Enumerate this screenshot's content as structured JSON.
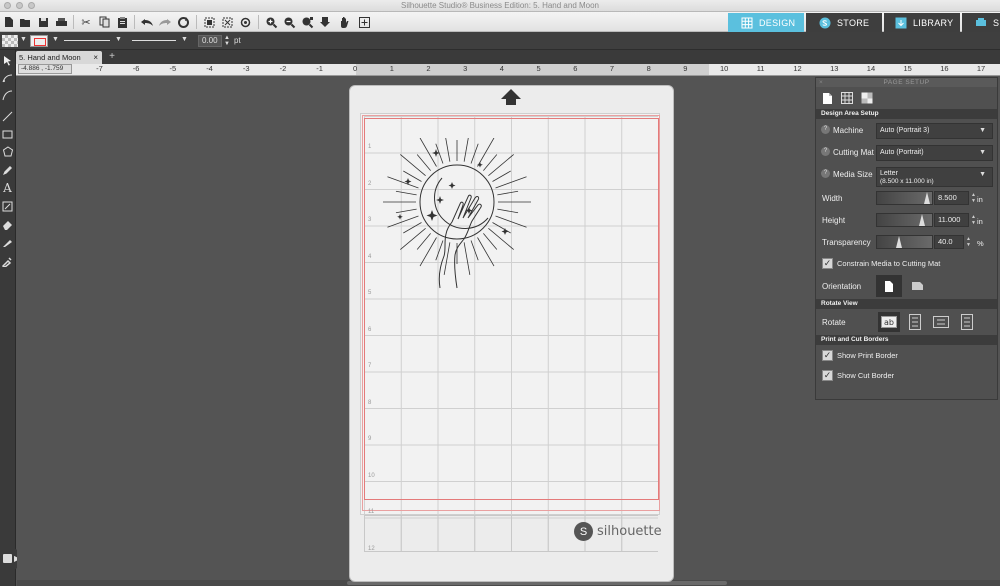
{
  "window": {
    "title": "Silhouette Studio® Business Edition: 5. Hand and Moon"
  },
  "toolbar": {
    "icons": [
      "new-icon",
      "open-icon",
      "save-icon",
      "print-icon",
      "cut-icon",
      "copy-icon",
      "paste-icon",
      "undo-icon",
      "redo-icon",
      "refresh-icon",
      "group-icon",
      "ungroup-icon",
      "select-all-icon",
      "zoom-in-icon",
      "zoom-out-icon",
      "zoom-fit-icon",
      "move-down-icon",
      "pan-hand-icon",
      "add-page-icon"
    ]
  },
  "top_tabs": [
    {
      "label": "DESIGN",
      "icon": "grid-icon",
      "active": true,
      "color": "#5bc0de"
    },
    {
      "label": "STORE",
      "icon": "store-icon",
      "active": false,
      "color": "#3e3e3e"
    },
    {
      "label": "LIBRARY",
      "icon": "library-icon",
      "active": false,
      "color": "#3e3e3e"
    },
    {
      "label": "S",
      "icon": "send-icon",
      "active": false,
      "color": "#3e3e3e"
    }
  ],
  "options": {
    "line_width": "0.00",
    "line_unit": "pt"
  },
  "document_tab": {
    "label": "5. Hand and Moon",
    "close": "×",
    "add": "+"
  },
  "ruler": {
    "coords": "-4.886 , -1.759",
    "ticks": [
      "-7",
      "-6",
      "-5",
      "-4",
      "-3",
      "-2",
      "-1",
      "0",
      "1",
      "2",
      "3",
      "4",
      "5",
      "6",
      "7",
      "8",
      "9",
      "10",
      "11",
      "12",
      "13",
      "14",
      "15",
      "16",
      "17"
    ]
  },
  "canvas": {
    "brand_text": "silhouette",
    "row_numbers": [
      "1",
      "2",
      "3",
      "4",
      "5",
      "6",
      "7",
      "8",
      "9",
      "10",
      "11",
      "12"
    ]
  },
  "page_setup": {
    "header": "PAGE SETUP",
    "design_area_title": "Design Area Setup",
    "machine_label": "Machine",
    "machine_value": "Auto (Portrait 3)",
    "cutting_mat_label": "Cutting Mat",
    "cutting_mat_value": "Auto (Portrait)",
    "media_size_label": "Media Size",
    "media_size_value": "Letter",
    "media_size_sub": "(8.500 x 11.000 in)",
    "width_label": "Width",
    "width_value": "8.500",
    "width_unit": "in",
    "height_label": "Height",
    "height_value": "11.000",
    "height_unit": "in",
    "transparency_label": "Transparency",
    "transparency_value": "40.0",
    "transparency_unit": "%",
    "constrain_label": "Constrain Media to Cutting Mat",
    "orientation_label": "Orientation",
    "rotate_view_title": "Rotate View",
    "rotate_label": "Rotate",
    "print_cut_title": "Print and Cut Borders",
    "show_print_border": "Show Print Border",
    "show_cut_border": "Show Cut Border"
  },
  "colors": {
    "accent": "#5bc0de",
    "cut_line": "#e47a7a"
  }
}
